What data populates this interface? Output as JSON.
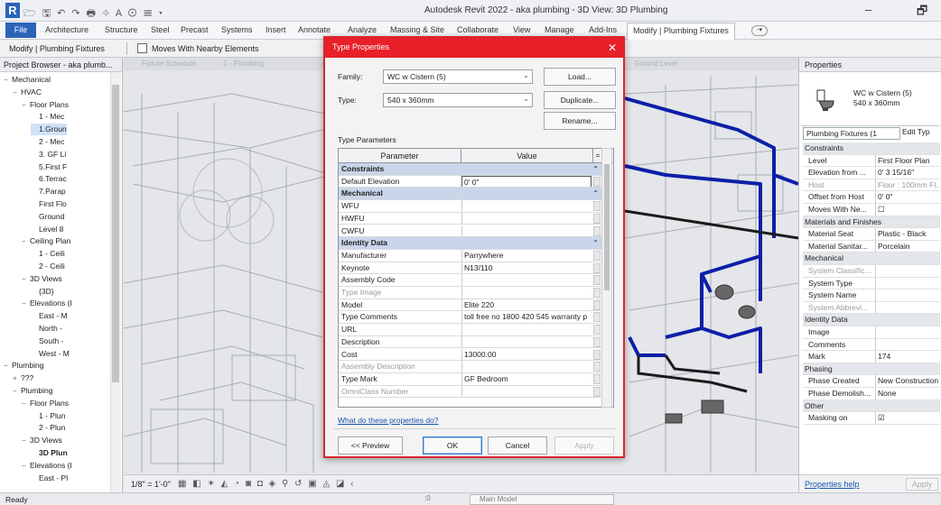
{
  "titlebar": {
    "title": "Autodesk Revit 2022 - aka plumbing - 3D View: 3D Plumbing",
    "minimize": "–",
    "restore": "🗗",
    "logo": "R"
  },
  "ribbon": {
    "tabs": [
      "File",
      "Architecture",
      "Structure",
      "Steel",
      "Precast",
      "Systems",
      "Insert",
      "Annotate",
      "Analyze",
      "Massing & Site",
      "Collaborate",
      "View",
      "Manage",
      "Add-Ins",
      "Modify | Plumbing Fixtures"
    ],
    "active_tab": "Modify | Plumbing Fixtures"
  },
  "context_bar": {
    "label": "Modify | Plumbing Fixtures",
    "checkbox_label": "Moves With Nearby Elements",
    "checkbox_checked": false
  },
  "project_browser": {
    "title": "Project Browser - aka plumb...",
    "items": [
      {
        "label": "Mechanical",
        "level": 1,
        "glyph": "−"
      },
      {
        "label": "HVAC",
        "level": 2,
        "glyph": "−"
      },
      {
        "label": "Floor Plans",
        "level": 3,
        "glyph": "−"
      },
      {
        "label": "1 - Mec",
        "level": 4,
        "glyph": ""
      },
      {
        "label": "1.Groun",
        "level": 4,
        "glyph": "",
        "selected": true
      },
      {
        "label": "2 - Mec",
        "level": 4,
        "glyph": ""
      },
      {
        "label": "3. GF Li",
        "level": 4,
        "glyph": ""
      },
      {
        "label": "5.First F",
        "level": 4,
        "glyph": ""
      },
      {
        "label": "6.Terrac",
        "level": 4,
        "glyph": ""
      },
      {
        "label": "7.Parap",
        "level": 4,
        "glyph": ""
      },
      {
        "label": "First Flo",
        "level": 4,
        "glyph": ""
      },
      {
        "label": "Ground",
        "level": 4,
        "glyph": ""
      },
      {
        "label": "Level 8",
        "level": 4,
        "glyph": ""
      },
      {
        "label": "Ceiling Plan",
        "level": 3,
        "glyph": "−"
      },
      {
        "label": "1 - Ceili",
        "level": 4,
        "glyph": ""
      },
      {
        "label": "2 - Ceili",
        "level": 4,
        "glyph": ""
      },
      {
        "label": "3D Views",
        "level": 3,
        "glyph": "−"
      },
      {
        "label": "{3D}",
        "level": 4,
        "glyph": ""
      },
      {
        "label": "Elevations (I",
        "level": 3,
        "glyph": "−"
      },
      {
        "label": "East - M",
        "level": 4,
        "glyph": ""
      },
      {
        "label": "North -",
        "level": 4,
        "glyph": ""
      },
      {
        "label": "South -",
        "level": 4,
        "glyph": ""
      },
      {
        "label": "West - M",
        "level": 4,
        "glyph": ""
      },
      {
        "label": "Plumbing",
        "level": 1,
        "glyph": "−"
      },
      {
        "label": "???",
        "level": 2,
        "glyph": "+"
      },
      {
        "label": "Plumbing",
        "level": 2,
        "glyph": "−"
      },
      {
        "label": "Floor Plans",
        "level": 3,
        "glyph": "−"
      },
      {
        "label": "1 - Plun",
        "level": 4,
        "glyph": ""
      },
      {
        "label": "2 - Plun",
        "level": 4,
        "glyph": ""
      },
      {
        "label": "3D Views",
        "level": 3,
        "glyph": "−"
      },
      {
        "label": "3D Plun",
        "level": 4,
        "glyph": "",
        "bold": true
      },
      {
        "label": "Elevations (I",
        "level": 3,
        "glyph": "−"
      },
      {
        "label": "East - Pl",
        "level": 4,
        "glyph": ""
      }
    ]
  },
  "viewport": {
    "tabs": [
      "Fixture Schedule",
      "1 - Plumbing",
      "Ground Level"
    ],
    "scale": "1/8\" = 1'-0\""
  },
  "dialog": {
    "title": "Type Properties",
    "close_glyph": "✕",
    "family_label": "Family:",
    "family_value": "WC w Cistern (5)",
    "type_label": "Type:",
    "type_value": "540 x 360mm",
    "load_label": "Load...",
    "duplicate_label": "Duplicate...",
    "rename_label": "Rename...",
    "params_title": "Type Parameters",
    "col_parameter": "Parameter",
    "col_value": "Value",
    "col_marker": "=",
    "rows": [
      {
        "name": "Constraints",
        "category": true
      },
      {
        "name": "Default Elevation",
        "value": "0' 0\"",
        "editing": true
      },
      {
        "name": "Mechanical",
        "category": true
      },
      {
        "name": "WFU",
        "value": ""
      },
      {
        "name": "HWFU",
        "value": ""
      },
      {
        "name": "CWFU",
        "value": ""
      },
      {
        "name": "Identity Data",
        "category": true
      },
      {
        "name": "Manufacturer",
        "value": "Parrywhere"
      },
      {
        "name": "Keynote",
        "value": "N13/110"
      },
      {
        "name": "Assembly Code",
        "value": ""
      },
      {
        "name": "Type Image",
        "value": "",
        "dim": true
      },
      {
        "name": "Model",
        "value": "Elite 220"
      },
      {
        "name": "Type Comments",
        "value": "toll free no 1800 420 545 warranty p"
      },
      {
        "name": "URL",
        "value": ""
      },
      {
        "name": "Description",
        "value": ""
      },
      {
        "name": "Cost",
        "value": "13000.00"
      },
      {
        "name": "Assembly Description",
        "value": "",
        "dim": true
      },
      {
        "name": "Type Mark",
        "value": "GF Bedroom"
      },
      {
        "name": "OmniClass Number",
        "value": "",
        "dim": true
      }
    ],
    "help_link": "What do these properties do?",
    "preview_label": "<< Preview",
    "ok_label": "OK",
    "cancel_label": "Cancel",
    "apply_label": "Apply"
  },
  "properties": {
    "title": "Properties",
    "type_name": "WC w Cistern (5)",
    "type_size": "540 x 360mm",
    "filter": "Plumbing Fixtures (1",
    "edit_type": "Edit Typ",
    "rows": [
      {
        "name": "Constraints",
        "category": true
      },
      {
        "name": "Level",
        "value": "First Floor Plan"
      },
      {
        "name": "Elevation from ...",
        "value": "0' 3 15/16\""
      },
      {
        "name": "Host",
        "value": "Floor : 100mm Fl...",
        "dim": true
      },
      {
        "name": "Offset from Host",
        "value": "0' 0\""
      },
      {
        "name": "Moves With Ne...",
        "value": "☐"
      },
      {
        "name": "Materials and Finishes",
        "category": true
      },
      {
        "name": "Material Seat",
        "value": "Plastic - Black"
      },
      {
        "name": "Material Sanitar...",
        "value": "Porcelain"
      },
      {
        "name": "Mechanical",
        "category": true
      },
      {
        "name": "System Classific...",
        "value": "",
        "dim": true
      },
      {
        "name": "System Type",
        "value": ""
      },
      {
        "name": "System Name",
        "value": ""
      },
      {
        "name": "System Abbrevi...",
        "value": "",
        "dim": true
      },
      {
        "name": "Identity Data",
        "category": true
      },
      {
        "name": "Image",
        "value": ""
      },
      {
        "name": "Comments",
        "value": ""
      },
      {
        "name": "Mark",
        "value": "174"
      },
      {
        "name": "Phasing",
        "category": true
      },
      {
        "name": "Phase Created",
        "value": "New Construction"
      },
      {
        "name": "Phase Demolish...",
        "value": "None"
      },
      {
        "name": "Other",
        "category": true
      },
      {
        "name": "Masking on",
        "value": "☑"
      }
    ],
    "help_link": "Properties help",
    "apply_label": "Apply"
  },
  "status": {
    "ready": "Ready",
    "model": "Main Model",
    "zero": ":0"
  },
  "colors": {
    "dialog_red": "#e8202a",
    "revit_blue": "#2a64b8",
    "pipe_blue": "#0c1fa8"
  }
}
